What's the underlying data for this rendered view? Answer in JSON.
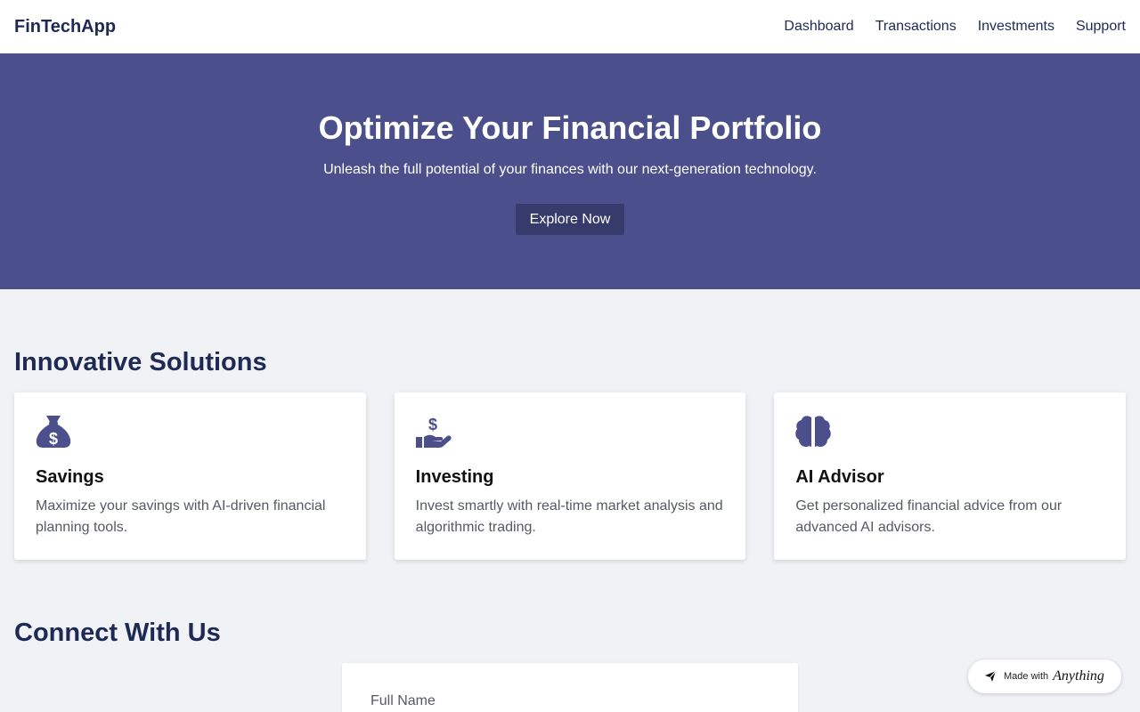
{
  "nav": {
    "brand": "FinTechApp",
    "links": [
      "Dashboard",
      "Transactions",
      "Investments",
      "Support"
    ]
  },
  "hero": {
    "title": "Optimize Your Financial Portfolio",
    "subtitle": "Unleash the full potential of your finances with our next-generation technology.",
    "cta": "Explore Now"
  },
  "solutions": {
    "title": "Innovative Solutions",
    "cards": [
      {
        "icon": "money-bag-icon",
        "title": "Savings",
        "desc": "Maximize your savings with AI-driven financial planning tools."
      },
      {
        "icon": "hand-dollar-icon",
        "title": "Investing",
        "desc": "Invest smartly with real-time market analysis and algorithmic trading."
      },
      {
        "icon": "brain-icon",
        "title": "AI Advisor",
        "desc": "Get personalized financial advice from our advanced AI advisors."
      }
    ]
  },
  "connect": {
    "title": "Connect With Us",
    "form": {
      "name_label": "Full Name"
    }
  },
  "badge": {
    "text": "Made with",
    "brand": "Anything"
  },
  "colors": {
    "primary": "#4b508c",
    "primary_dark": "#363b6b",
    "heading": "#1e2a55",
    "background": "#f0f2f5"
  }
}
